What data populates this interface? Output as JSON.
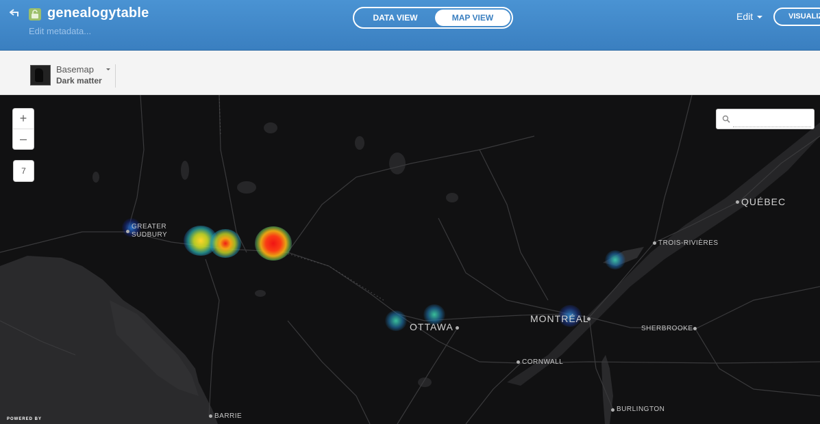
{
  "header": {
    "title": "genealogytable",
    "edit_metadata": "Edit metadata...",
    "view_toggle": {
      "data_view": "DATA VIEW",
      "map_view": "MAP VIEW",
      "active": "map_view"
    },
    "edit_menu": "Edit",
    "visualize_button": "VISUALIZE",
    "colors": {
      "header_bg": "#4a93d3",
      "lock_badge": "#9cbf6a"
    }
  },
  "toolbar": {
    "basemap_label": "Basemap",
    "basemap_value": "Dark matter"
  },
  "map": {
    "zoom_in": "+",
    "zoom_out": "–",
    "zoom_level": "7",
    "search_placeholder": "",
    "attribution": "POWERED BY",
    "cities": {
      "greater": "GREATER",
      "sudbury": "SUDBURY",
      "ottawa": "OTTAWA",
      "montreal": "MONTRÉAL",
      "quebec": "QUÉBEC",
      "trois_rivieres": "TROIS-RIVIÈRES",
      "sherbrooke": "SHERBROOKE",
      "cornwall": "CORNWALL",
      "barrie": "BARRIE",
      "burlington": "BURLINGTON"
    }
  }
}
